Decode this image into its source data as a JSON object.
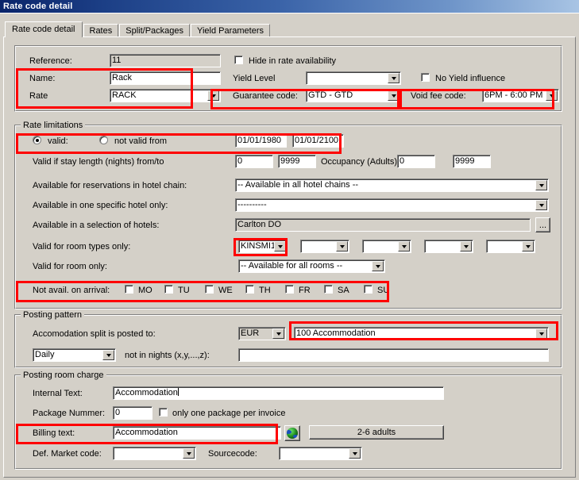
{
  "window": {
    "title": "Rate code detail"
  },
  "tabs": [
    {
      "label": "Rate code detail",
      "active": true
    },
    {
      "label": "Rates",
      "active": false
    },
    {
      "label": "Split/Packages",
      "active": false
    },
    {
      "label": "Yield Parameters",
      "active": false
    }
  ],
  "general": {
    "reference_label": "Reference:",
    "reference_value": "11",
    "name_label": "Name:",
    "name_value": "Rack",
    "rate_label": "Rate",
    "rate_value": "RACK",
    "hide_in_rate_availability_label": "Hide in rate availability",
    "hide_in_rate_availability_checked": false,
    "yield_level_label": "Yield Level",
    "yield_level_value": "",
    "no_yield_influence_label": "No Yield influence",
    "no_yield_influence_checked": false,
    "guarantee_code_label": "Guarantee code:",
    "guarantee_code_value": "GTD  - GTD",
    "void_fee_code_label": "Void fee code:",
    "void_fee_code_value": "6PM  - 6:00 PM"
  },
  "rate_limitations": {
    "group_label": "Rate limitations",
    "valid_label": "valid:",
    "valid_selected": true,
    "not_valid_from_label": "not valid from",
    "not_valid_from_selected": false,
    "date_from": "01/01/1980",
    "date_to": "01/01/2100",
    "stay_length_label": "Valid if stay length (nights) from/to",
    "stay_length_from": "0",
    "stay_length_to": "9999",
    "occupancy_label": "Occupancy (Adults):",
    "occupancy_from": "0",
    "occupancy_to": "9999",
    "chain_label": "Available for reservations in hotel chain:",
    "chain_value": "-- Available in all hotel chains --",
    "specific_hotel_label": "Available in one specific hotel only:",
    "specific_hotel_value": "----------",
    "selection_hotels_label": "Available in a selection of hotels:",
    "selection_hotels_value": "Carlton DO",
    "browse_button_label": "...",
    "room_types_label": "Valid for room types only:",
    "room_types": [
      "KINSMI1",
      "",
      "",
      "",
      ""
    ],
    "room_only_label": "Valid for room only:",
    "room_only_value": "-- Available for all rooms --",
    "not_avail_label": "Not avail. on arrival:",
    "weekdays": [
      {
        "label": "MO",
        "checked": false
      },
      {
        "label": "TU",
        "checked": false
      },
      {
        "label": "WE",
        "checked": false
      },
      {
        "label": "TH",
        "checked": false
      },
      {
        "label": "FR",
        "checked": false
      },
      {
        "label": "SA",
        "checked": false
      },
      {
        "label": "SU",
        "checked": false
      }
    ]
  },
  "posting_pattern": {
    "group_label": "Posting pattern",
    "split_posted_label": "Accomodation split is posted to:",
    "currency_value": "EUR",
    "account_value": "100 Accommodation",
    "frequency_value": "Daily",
    "not_in_nights_label": "not in nights (x,y,...,z):",
    "not_in_nights_value": ""
  },
  "posting_room_charge": {
    "group_label": "Posting room charge",
    "internal_text_label": "Internal Text:",
    "internal_text_value": "Accommodation",
    "package_number_label": "Package Nummer:",
    "package_number_value": "0",
    "only_one_package_label": "only one package per invoice",
    "only_one_package_checked": false,
    "billing_text_label": "Billing text:",
    "billing_text_value": "Accommodation",
    "translate_icon": "globe-icon",
    "adults_button_label": "2-6 adults",
    "market_code_label": "Def. Market code:",
    "market_code_value": "",
    "sourcecode_label": "Sourcecode:",
    "sourcecode_value": ""
  },
  "colors": {
    "highlight": "#ff0000",
    "titlebar_start": "#0a246a",
    "face": "#d4d0c8"
  }
}
